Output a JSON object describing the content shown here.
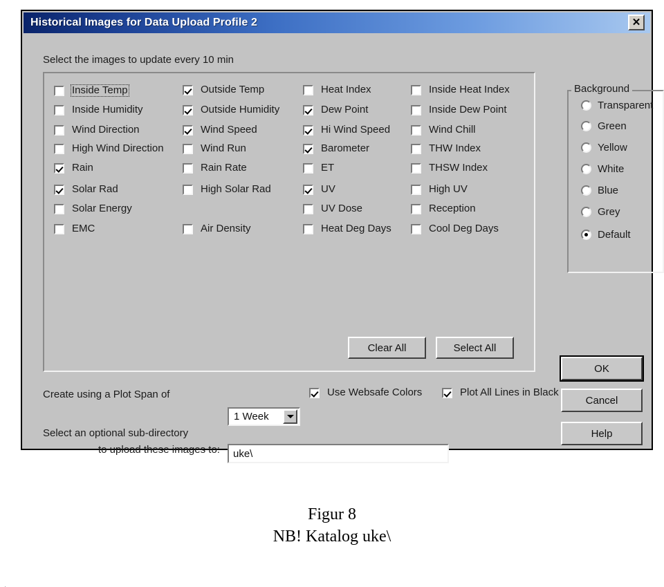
{
  "window": {
    "title": "Historical Images for Data Upload Profile 2",
    "close_label": "✕",
    "instruction": "Select the images to update every 10 min"
  },
  "checkbox_columns": [
    {
      "items": [
        {
          "label": "Inside Temp",
          "checked": false,
          "focused": true
        },
        {
          "label": "Inside Humidity",
          "checked": false,
          "focused": false
        },
        {
          "label": "Wind Direction",
          "checked": false,
          "focused": false
        },
        {
          "label": "High Wind Direction",
          "checked": false,
          "focused": false
        },
        {
          "label": "Rain",
          "checked": true,
          "focused": false
        },
        {
          "label": "Solar Rad",
          "checked": true,
          "focused": false
        },
        {
          "label": "Solar Energy",
          "checked": false,
          "focused": false
        },
        {
          "label": "EMC",
          "checked": false,
          "focused": false
        }
      ]
    },
    {
      "items": [
        {
          "label": "Outside Temp",
          "checked": true,
          "focused": false
        },
        {
          "label": "Outside Humidity",
          "checked": true,
          "focused": false
        },
        {
          "label": "Wind Speed",
          "checked": true,
          "focused": false
        },
        {
          "label": "Wind Run",
          "checked": false,
          "focused": false
        },
        {
          "label": "Rain Rate",
          "checked": false,
          "focused": false
        },
        {
          "label": "High Solar Rad",
          "checked": false,
          "focused": false
        },
        {
          "label": "",
          "checked": false,
          "focused": false
        },
        {
          "label": "Air Density",
          "checked": false,
          "focused": false
        }
      ]
    },
    {
      "items": [
        {
          "label": "Heat Index",
          "checked": false,
          "focused": false
        },
        {
          "label": "Dew Point",
          "checked": true,
          "focused": false
        },
        {
          "label": "Hi Wind Speed",
          "checked": true,
          "focused": false
        },
        {
          "label": "Barometer",
          "checked": true,
          "focused": false
        },
        {
          "label": "ET",
          "checked": false,
          "focused": false
        },
        {
          "label": "UV",
          "checked": true,
          "focused": false
        },
        {
          "label": "UV Dose",
          "checked": false,
          "focused": false
        },
        {
          "label": "Heat Deg Days",
          "checked": false,
          "focused": false
        }
      ]
    },
    {
      "items": [
        {
          "label": "Inside Heat Index",
          "checked": false,
          "focused": false
        },
        {
          "label": "Inside Dew Point",
          "checked": false,
          "focused": false
        },
        {
          "label": "Wind Chill",
          "checked": false,
          "focused": false
        },
        {
          "label": "THW Index",
          "checked": false,
          "focused": false
        },
        {
          "label": "THSW Index",
          "checked": false,
          "focused": false
        },
        {
          "label": "High UV",
          "checked": false,
          "focused": false
        },
        {
          "label": "Reception",
          "checked": false,
          "focused": false
        },
        {
          "label": "Cool Deg Days",
          "checked": false,
          "focused": false
        }
      ]
    }
  ],
  "background_group": {
    "title": "Background",
    "options": [
      {
        "label": "Transparent",
        "selected": false
      },
      {
        "label": "Green",
        "selected": false
      },
      {
        "label": "Yellow",
        "selected": false
      },
      {
        "label": "White",
        "selected": false
      },
      {
        "label": "Blue",
        "selected": false
      },
      {
        "label": "Grey",
        "selected": false
      },
      {
        "label": "Default",
        "selected": true
      }
    ]
  },
  "panel_buttons": {
    "clear_all": "Clear All",
    "select_all": "Select All"
  },
  "bottom": {
    "plot_span_label": "Create using a Plot Span of",
    "plot_span_value": "1 Week",
    "websafe_label": "Use Websafe Colors",
    "websafe_checked": true,
    "black_lines_label": "Plot All Lines in Black",
    "black_lines_checked": true,
    "subdir_label_line1": "Select an optional sub-directory",
    "subdir_label_line2": "to upload these images to:",
    "subdir_value": "uke\\"
  },
  "action_buttons": {
    "ok": "OK",
    "cancel": "Cancel",
    "help": "Help"
  },
  "caption": {
    "line1": "Figur 8",
    "line2": "NB! Katalog uke\\",
    "corner_mark": "."
  },
  "colors": {
    "titlebar_start": "#0a246a",
    "titlebar_end": "#a8c8ef",
    "dialog_face": "#c3c3c3",
    "field_background": "#ffffff"
  }
}
